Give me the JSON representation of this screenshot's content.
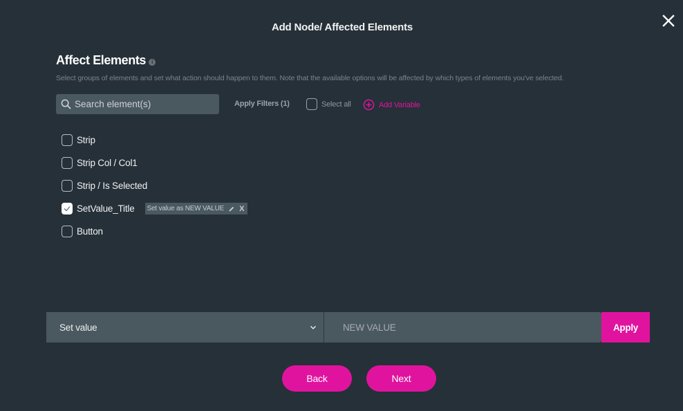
{
  "dialog": {
    "title": "Add Node/ Affected Elements",
    "close_icon": "close-icon"
  },
  "section": {
    "title": "Affect Elements",
    "info_icon": "i",
    "description": "Select groups of elements and set what action should happen to them. Note that the available options will be affected by which types of elements you've selected."
  },
  "toolbar": {
    "search_placeholder": "Search element(s)",
    "apply_filters_label": "Apply Filters (1)",
    "select_all_label": "Select all",
    "select_all_checked": false,
    "add_variable_label": "Add Variable"
  },
  "elements": [
    {
      "label": "Strip",
      "checked": false
    },
    {
      "label": "Strip Col / Col1",
      "checked": false
    },
    {
      "label": "Strip / Is Selected",
      "checked": false
    },
    {
      "label": "SetValue_Title",
      "checked": true,
      "tag": "Set value as NEW VALUE",
      "tag_remove": "X"
    },
    {
      "label": "Button",
      "checked": false
    }
  ],
  "action_bar": {
    "action_selected": "Set value",
    "value_placeholder": "NEW VALUE",
    "apply_label": "Apply"
  },
  "footer": {
    "back_label": "Back",
    "next_label": "Next"
  },
  "colors": {
    "background": "#263038",
    "field": "#4a5860",
    "accent": "#e0139f"
  }
}
